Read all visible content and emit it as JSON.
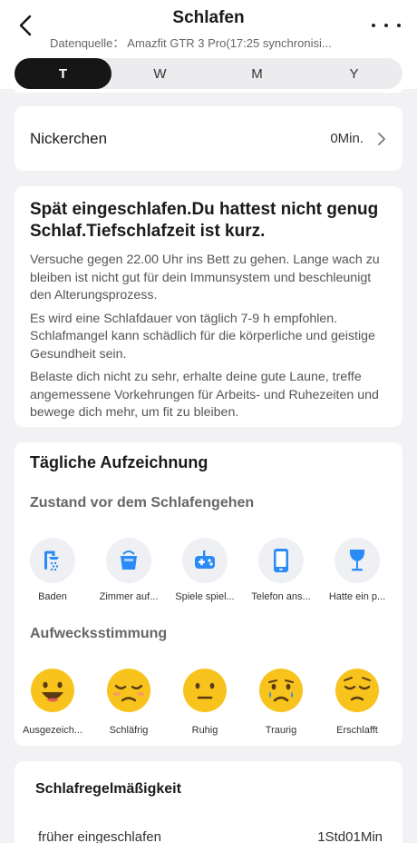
{
  "header": {
    "title": "Schlafen",
    "subtitle": "Datenquelle： Amazfit GTR 3 Pro(17:25 synchronisi..."
  },
  "tabs": [
    {
      "label": "T",
      "active": true
    },
    {
      "label": "W",
      "active": false
    },
    {
      "label": "M",
      "active": false
    },
    {
      "label": "Y",
      "active": false
    }
  ],
  "nap": {
    "label": "Nickerchen",
    "value": "0Min."
  },
  "advice": {
    "headline": "Spät eingeschlafen.Du hattest nicht genug Schlaf.Tiefschlafzeit ist kurz.",
    "paragraphs": [
      "Versuche gegen 22.00 Uhr ins Bett zu gehen. Lange wach zu bleiben ist nicht gut für dein Immunsystem und beschleunigt den Alterungsprozess.",
      "Es wird eine Schlafdauer von täglich 7-9 h empfohlen. Schlafmangel kann schädlich für die körperliche und geistige Gesundheit sein.",
      "Belaste dich nicht zu sehr, erhalte deine gute Laune, treffe angemessene Vorkehrungen für Arbeits- und Ruhezeiten und bewege dich mehr, um fit zu bleiben."
    ]
  },
  "daily": {
    "title": "Tägliche Aufzeichnung",
    "before_sleep_label": "Zustand vor dem Schlafengehen",
    "activities": [
      {
        "label": "Baden",
        "icon": "shower-icon"
      },
      {
        "label": "Zimmer auf...",
        "icon": "bucket-icon"
      },
      {
        "label": "Spiele spiel...",
        "icon": "gamepad-icon"
      },
      {
        "label": "Telefon ans...",
        "icon": "phone-icon"
      },
      {
        "label": "Hatte ein p...",
        "icon": "wine-glass-icon"
      }
    ],
    "wakeup_label": "Aufwecksstimmung",
    "moods": [
      {
        "label": "Ausgezeich...",
        "icon": "happy-face-icon"
      },
      {
        "label": "Schläfrig",
        "icon": "sleepy-face-icon"
      },
      {
        "label": "Ruhig",
        "icon": "calm-face-icon"
      },
      {
        "label": "Traurig",
        "icon": "sad-face-icon"
      },
      {
        "label": "Erschlafft",
        "icon": "exhausted-face-icon"
      }
    ]
  },
  "regularity": {
    "title": "Schlafregelmäßigkeit",
    "row_label": "früher eingeschlafen",
    "row_value": "1Std01Min"
  },
  "colors": {
    "accent_blue": "#2a8af6",
    "emoji_yellow": "#f7c31c",
    "active_tab": "#161616"
  }
}
